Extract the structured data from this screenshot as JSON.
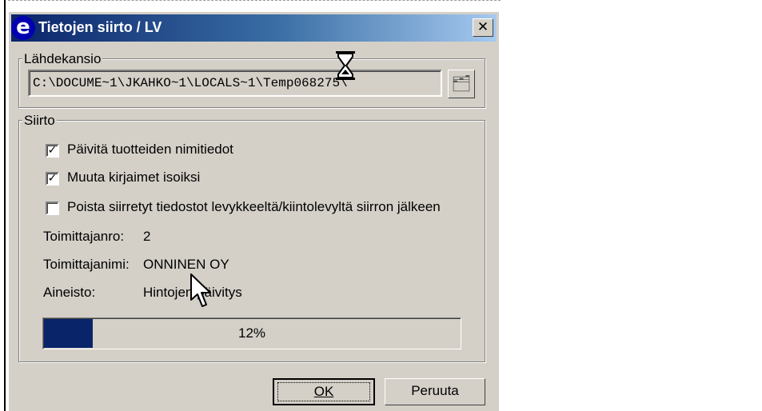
{
  "window": {
    "title": "Tietojen siirto / LV",
    "app_icon": "e",
    "close_glyph": "✕"
  },
  "source_group": {
    "label": "Lähdekansio",
    "path_value": "C:\\DOCUME~1\\JKAHKO~1\\LOCALS~1\\Temp068275\\"
  },
  "transfer_group": {
    "label": "Siirto",
    "checkboxes": [
      {
        "label": "Päivitä tuotteiden nimitiedot",
        "checked": true
      },
      {
        "label": "Muuta kirjaimet isoiksi",
        "checked": true
      },
      {
        "label": "Poista siirretyt tiedostot levykkeeltä/kiintolevyltä siirron jälkeen",
        "checked": false
      }
    ],
    "fields": [
      {
        "label": "Toimittajanro:",
        "value": "2"
      },
      {
        "label": "Toimittajanimi:",
        "value": "ONNINEN OY"
      },
      {
        "label": "Aineisto:",
        "value": "Hintojen päivitys"
      }
    ],
    "progress": {
      "percent": 12,
      "text": "12%"
    }
  },
  "buttons": {
    "ok": "OK",
    "cancel": "Peruuta"
  },
  "colors": {
    "dialog_bg": "#d4d0c8",
    "title_start": "#0a246a",
    "title_end": "#a6caf0",
    "progress_fill": "#0a246a"
  },
  "icons": {
    "app": "app-logo-icon",
    "close": "close-icon",
    "browse": "folder-browse-icon",
    "busy": "hourglass-icon",
    "pointer": "mouse-pointer-icon"
  }
}
